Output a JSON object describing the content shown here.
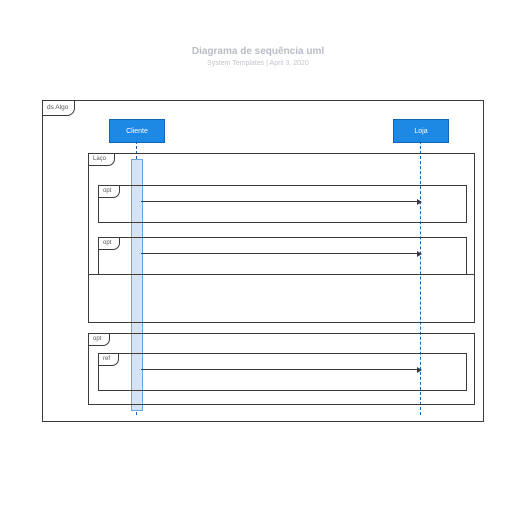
{
  "title": "Diagrama de sequência uml",
  "subtitle": "System Templates | April 3, 2020",
  "outer_tab": "ds Algo",
  "participants": {
    "cliente": "Cliente",
    "loja": "Loja"
  },
  "frames": {
    "loop": "Laço",
    "opt1": "opt",
    "opt2": "opt",
    "opt3": "opt",
    "ref": "ref"
  }
}
